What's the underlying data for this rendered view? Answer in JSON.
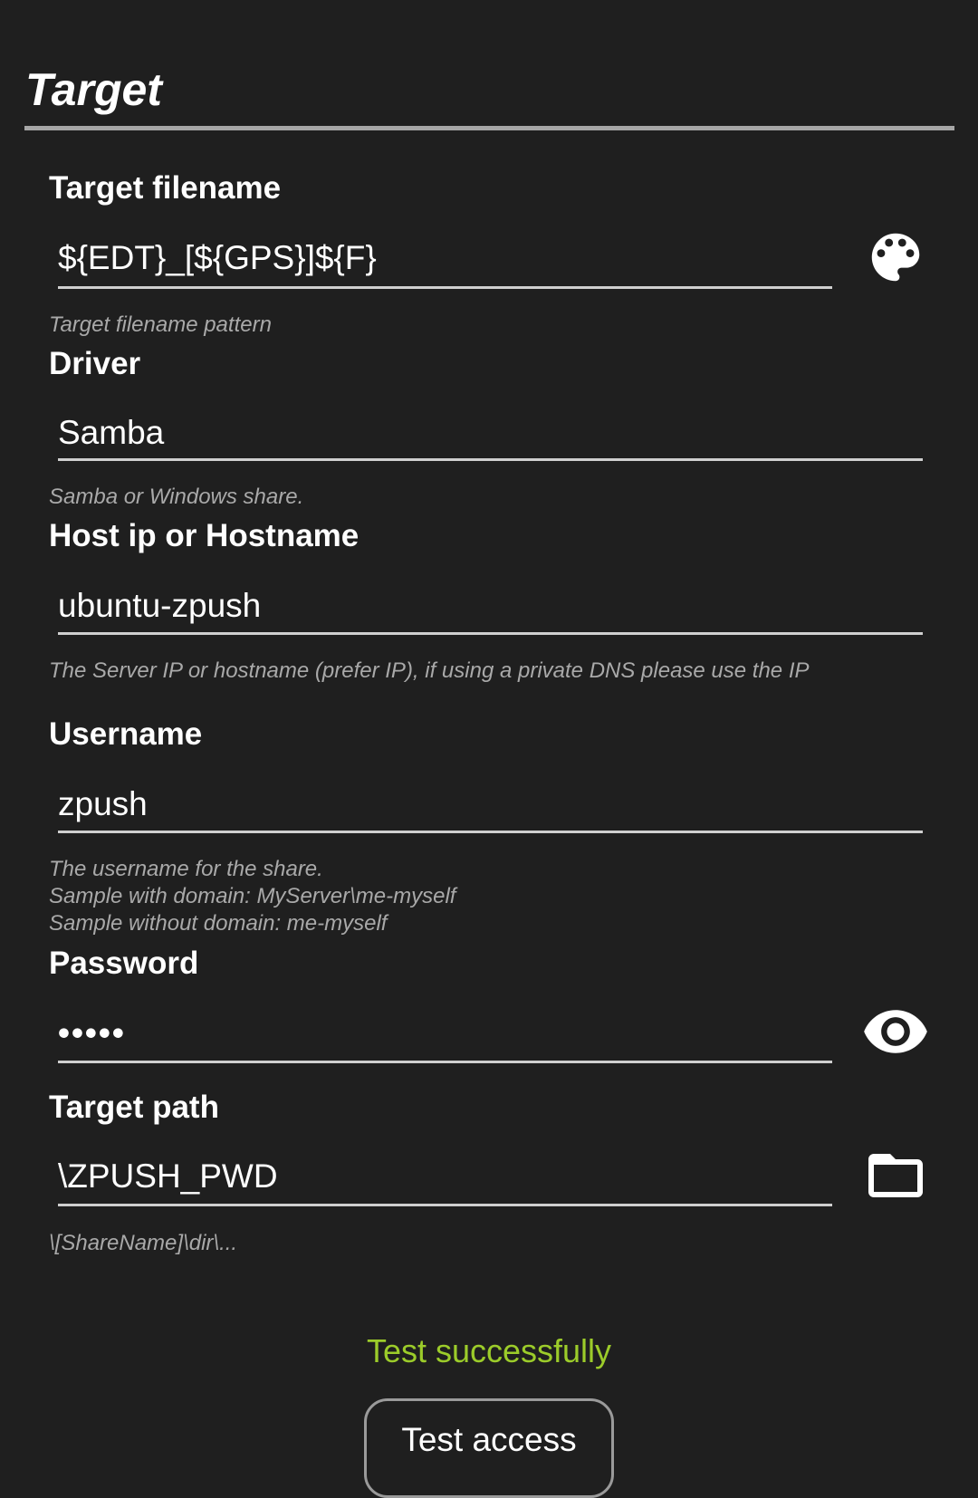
{
  "section": {
    "title": "Target"
  },
  "fields": {
    "filename": {
      "label": "Target filename",
      "value": "${EDT}_[${GPS}]${F}",
      "hint": "Target filename pattern",
      "icon": "palette-icon"
    },
    "driver": {
      "label": "Driver",
      "value": "Samba",
      "hint": "Samba or Windows share."
    },
    "host": {
      "label": "Host ip or Hostname",
      "value": "ubuntu-zpush",
      "hint": "The Server IP or hostname (prefer IP), if using a private DNS please use the IP"
    },
    "username": {
      "label": "Username",
      "value": "zpush",
      "hint_lines": [
        "The username for the share.",
        "Sample with domain: MyServer\\me-myself",
        "Sample without domain: me-myself"
      ]
    },
    "password": {
      "label": "Password",
      "value": "•••••",
      "icon": "eye-icon"
    },
    "path": {
      "label": "Target path",
      "value": "\\ZPUSH_PWD",
      "hint": "\\[ShareName]\\dir\\...",
      "icon": "folder-icon"
    }
  },
  "status": {
    "text": "Test successfully",
    "color": "#9ccc2a"
  },
  "actions": {
    "test_access_label": "Test access"
  }
}
